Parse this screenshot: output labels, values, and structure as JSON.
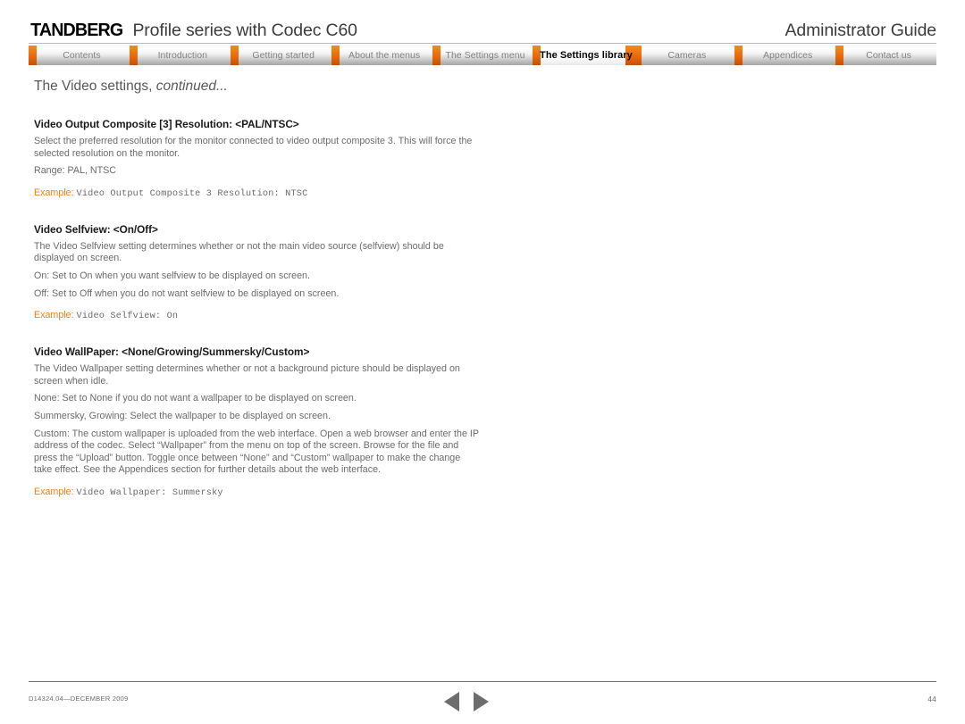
{
  "header": {
    "brand": "TANDBERG",
    "product_title": "Profile series with Codec C60",
    "guide_title": "Administrator Guide"
  },
  "tabs": [
    {
      "label": "Contents",
      "active": false
    },
    {
      "label": "Introduction",
      "active": false
    },
    {
      "label": "Getting started",
      "active": false
    },
    {
      "label": "About the menus",
      "active": false
    },
    {
      "label": "The Settings menu",
      "active": false
    },
    {
      "label": "The Settings library",
      "active": true
    },
    {
      "label": "Cameras",
      "active": false
    },
    {
      "label": "Appendices",
      "active": false
    },
    {
      "label": "Contact us",
      "active": false
    }
  ],
  "page": {
    "heading_main": "The Video settings, ",
    "heading_italic": "continued...",
    "settings": [
      {
        "title": "Video Output Composite [3] Resolution: <PAL/NTSC>",
        "paragraphs": [
          "Select the preferred resolution for the monitor connected to video output composite 3. This will force the selected resolution on the monitor.",
          "Range: PAL, NTSC"
        ],
        "example_label": "Example:",
        "example_code": "Video Output Composite 3 Resolution: NTSC"
      },
      {
        "title": "Video Selfview: <On/Off>",
        "paragraphs": [
          "The Video Selfview setting determines whether or not the main video source (selfview) should be displayed on screen.",
          "On: Set to On when you want selfview to be displayed on screen.",
          "Off: Set to Off when you do not want selfview to be displayed on screen."
        ],
        "example_label": "Example:",
        "example_code": "Video Selfview: On"
      },
      {
        "title": "Video WallPaper: <None/Growing/Summersky/Custom>",
        "paragraphs": [
          "The Video Wallpaper setting determines whether or not a background picture should be displayed on screen when idle.",
          "None: Set to None if you do not want a wallpaper to be displayed on screen.",
          "Summersky, Growing: Select the wallpaper to be displayed on screen.",
          "Custom: The custom wallpaper is uploaded from the web interface. Open a web browser and enter the IP address of the codec. Select “Wallpaper” from the menu on top of the screen. Browse for the file and press the “Upload” button. Toggle once between “None” and “Custom” wallpaper to make the change take effect. See the Appendices section for further details about the web interface."
        ],
        "example_label": "Example:",
        "example_code": "Video Wallpaper: Summersky"
      }
    ]
  },
  "footer": {
    "document_id": "D14324.04—DECEMBER 2009",
    "page_number": "44",
    "prev_icon": "triangle-left-icon",
    "next_icon": "triangle-right-icon"
  },
  "colors": {
    "accent_orange": "#f07f1a",
    "text_grey": "#6a6a6c",
    "heading_black": "#1a1a1c"
  }
}
